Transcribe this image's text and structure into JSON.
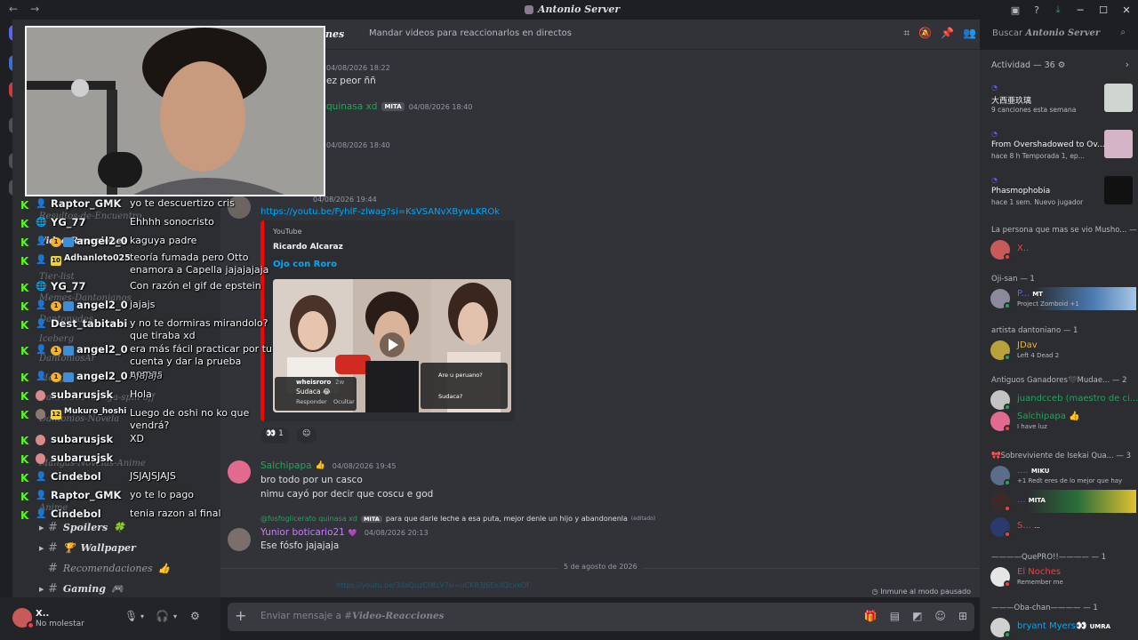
{
  "window": {
    "title": "Antonio Server",
    "nav_back": "←",
    "nav_fwd": "→",
    "controls": [
      "─",
      "☐",
      "✕"
    ]
  },
  "titlebar_icons": [
    "inbox-icon",
    "help-icon",
    "download-icon"
  ],
  "channel_header": {
    "name": "Video-Reacciones",
    "name_visible": "nes",
    "topic": "Mandar videos para reaccionarlos en directos",
    "search_label": "Buscar",
    "search_server": "Antonio Server"
  },
  "sidebar": {
    "categories": [
      {
        "label": "Resultos-de-Encuentro"
      },
      {
        "label": "Video-Reacciones"
      },
      {
        "label": "Tier-list"
      },
      {
        "label": "Memes-Dantonianos"
      },
      {
        "label": "Dantonudes"
      },
      {
        "label": "Iceberg"
      },
      {
        "label": "DantoniosAr"
      },
      {
        "label": "Manga"
      },
      {
        "label": "Dantonios-manga-spin-off"
      },
      {
        "label": "Dantonios-Novela"
      },
      {
        "label": "Mangas-Novelas-Anime"
      },
      {
        "label": "Anime"
      }
    ],
    "channels": [
      {
        "label": "Spoilers",
        "emoji": "🍀"
      },
      {
        "label": "Wallpaper",
        "emoji": "🏆"
      },
      {
        "label": "Recomendaciones",
        "emoji": "👍"
      },
      {
        "label": "Gaming",
        "emoji": "🎮"
      }
    ]
  },
  "overlay_chat": [
    {
      "user": "Raptor_GMK",
      "badges": [],
      "msg": "yo te descuertizo cris"
    },
    {
      "user": "YG_77",
      "badges": [
        "globe"
      ],
      "msg": "Ehhhh sonocristo"
    },
    {
      "user": "angel2_0",
      "badges": [
        "1",
        "tw"
      ],
      "msg": "kaguya padre"
    },
    {
      "user": "Adhanloto025",
      "badges": [
        "10"
      ],
      "msg": "teoría fumada pero Otto enamora a Capella jajajajaja"
    },
    {
      "user": "YG_77",
      "badges": [
        "globe"
      ],
      "msg": "Con razón el gif de epstein"
    },
    {
      "user": "angel2_0",
      "badges": [
        "1",
        "tw"
      ],
      "msg": "jajajs"
    },
    {
      "user": "Dest_tabitabi",
      "badges": [],
      "msg": "y no te dormiras mirandolo? que tiraba xd"
    },
    {
      "user": "angel2_0",
      "badges": [
        "1",
        "tw"
      ],
      "msg": "era más fácil practicar por tu cuenta y dar la prueba nomas"
    },
    {
      "user": "angel2_0",
      "badges": [
        "1",
        "tw"
      ],
      "msg": "Ajajaja"
    },
    {
      "user": "subarusjsk",
      "badges": [
        "av"
      ],
      "msg": "Hola"
    },
    {
      "user": "Mukuro_hoshi",
      "badges": [
        "av",
        "12"
      ],
      "msg": "Luego de oshi no ko que vendrá?"
    },
    {
      "user": "subarusjsk",
      "badges": [
        "av"
      ],
      "msg": "XD"
    },
    {
      "user": "subarusjsk",
      "badges": [
        "av"
      ],
      "msg": ""
    },
    {
      "user": "Cindebol",
      "badges": [],
      "msg": "JSJAJSJAJS"
    },
    {
      "user": "Raptor_GMK",
      "badges": [],
      "msg": "yo te lo pago"
    },
    {
      "user": "Cindebol",
      "badges": [],
      "msg": "tenia razon al final"
    }
  ],
  "messages": {
    "m1": {
      "ts": "04/08/2026 18:22",
      "text": "ez peor ññ"
    },
    "m2": {
      "user": "quinasa xd",
      "tag": "MITA",
      "ts": "04/08/2026 18:40"
    },
    "m3": {
      "ts": "04/08/2026 18:40"
    },
    "m4": {
      "ts": "04/08/2026 19:44",
      "link": "https://youtu.be/FyhlF-zlwag?si=KsVSANvXBywLKROk"
    },
    "embed": {
      "provider": "YouTube",
      "author": "Ricardo Alcaraz",
      "title": "Ojo con Roro",
      "thumb_caption_user": "wheisroro",
      "thumb_caption_time": "2w",
      "thumb_caption_text": "Sudaca 😂",
      "thumb_reply": "Responder",
      "thumb_hide": "Ocultar",
      "thumb_q1": "Are u peruano?",
      "thumb_q2": "Sudaca?"
    },
    "reactions": [
      {
        "emoji": "👀",
        "count": "1"
      }
    ],
    "m5": {
      "user": "Salchipapa",
      "badge": "👍",
      "ts": "04/08/2026 19:45",
      "lines": [
        "bro todo por un casco",
        "nimu cayó por decir que coscu e god"
      ]
    },
    "m6": {
      "reply_user": "@fosfoglicerato quinasa xd",
      "reply_tag": "MITA",
      "reply_text": "para que darle leche a esa puta, mejor denle un hijo y abandonenla",
      "reply_edited": "(editado)",
      "user": "Yunior boticario21",
      "badge": "💜",
      "ts": "04/08/2026 20:13",
      "text": "Ese fósfo jajajaja"
    },
    "date_divider": "5 de agosto de 2026",
    "faded_link": "https://youtu.be/3daQuzCHtcV?si=uCK83J6ExdQcxkOf",
    "immune": "Inmune al modo pausado"
  },
  "composer": {
    "placeholder_prefix": "Enviar mensaje a #",
    "placeholder_channel": "Video-Reacciones"
  },
  "user_panel": {
    "name": "X..",
    "status": "No molestar"
  },
  "activity": {
    "header": "Actividad — 36",
    "cards": [
      {
        "name": "大西亜玖璃",
        "sub": "9 canciones esta semana"
      },
      {
        "name": "From Overshadowed to Ov...",
        "sub": "hace 8 h",
        "sub2": "Temporada 1, ep..."
      },
      {
        "name": "Phasmophobia",
        "sub": "hace 1 sem.",
        "sub2": "Nuevo jugador"
      }
    ],
    "sections": [
      {
        "title": "La persona que mas se vio Musho... — 1",
        "members": [
          {
            "name": "X..",
            "color": "#f23f43",
            "sub": ""
          }
        ]
      },
      {
        "title": "Oji-san — 1",
        "members": [
          {
            "name": "P...",
            "color": "#5865f2",
            "tag": "MT",
            "sub": "Project Zomboid +1"
          }
        ]
      },
      {
        "title": "artista dantoniano — 1",
        "members": [
          {
            "name": "JDav",
            "color": "#f0b232",
            "sub": "Left 4 Dead 2"
          }
        ]
      },
      {
        "title": "Antiguos Ganadores🖤Mudae... — 2",
        "members": [
          {
            "name": "juandcceb (maestro de ci...",
            "color": "#23a55a",
            "sub": ""
          },
          {
            "name": "Salchipapa 👍",
            "color": "#23a55a",
            "sub": "I have luz"
          }
        ]
      },
      {
        "title": "🎀Sobreviviente de Isekai Qua... — 3",
        "members": [
          {
            "name": "....",
            "color": "#5865f2",
            "tag": "MIKU",
            "sub": "+1 Redt eres de lo mejor que hay"
          },
          {
            "name": "...",
            "color": "#5865f2",
            "tag": "MITA",
            "sub": ""
          },
          {
            "name": "S...",
            "color": "#f23f43",
            "tag": "...",
            "sub": ""
          }
        ]
      },
      {
        "title": "————QuePRO!!———— — 1",
        "members": [
          {
            "name": "El Noches",
            "color": "#f23f43",
            "sub": "Remember me"
          }
        ]
      },
      {
        "title": "———Oba-chan———— — 1",
        "members": [
          {
            "name": "bryant Myers👀",
            "color": "#00a8fc",
            "tag": "UMRA",
            "sub": ""
          }
        ]
      }
    ]
  }
}
